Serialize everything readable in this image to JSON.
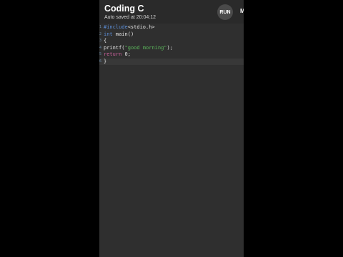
{
  "app": {
    "title": "Coding C",
    "subtitle": "Auto saved at 20:04:12",
    "run_label": "RUN",
    "more_label": "M"
  },
  "editor": {
    "lines": [
      {
        "number": "1",
        "parts": [
          {
            "t": "#include",
            "c": "kw-pre"
          },
          {
            "t": "<stdio.h>",
            "c": ""
          }
        ]
      },
      {
        "number": "2",
        "parts": [
          {
            "t": "int",
            "c": "kw-type"
          },
          {
            "t": " main()",
            "c": ""
          }
        ]
      },
      {
        "number": "3",
        "parts": [
          {
            "t": "{",
            "c": ""
          }
        ]
      },
      {
        "number": "4",
        "parts": [
          {
            "t": "printf(",
            "c": ""
          },
          {
            "t": "\"good morning\"",
            "c": "str"
          },
          {
            "t": ");",
            "c": ""
          }
        ]
      },
      {
        "number": "5",
        "parts": [
          {
            "t": "return",
            "c": "kw-ret"
          },
          {
            "t": " 0;",
            "c": ""
          }
        ]
      },
      {
        "number": "6",
        "parts": [
          {
            "t": "}",
            "c": ""
          }
        ]
      }
    ],
    "active_line": 6
  },
  "colors": {
    "background": "#2f2f2f",
    "keyword": "#5b8dd6",
    "string": "#5cb85c",
    "return_keyword": "#c8609a"
  }
}
